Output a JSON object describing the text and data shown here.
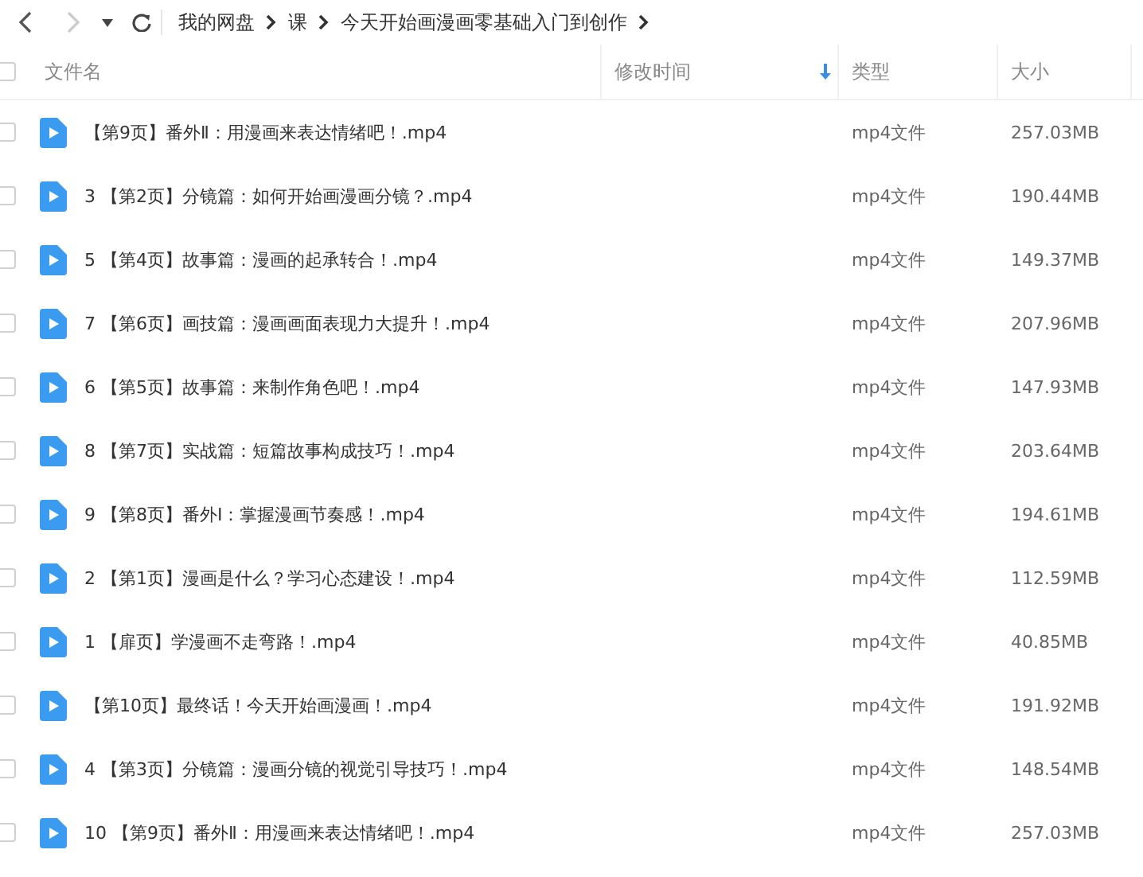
{
  "nav": {
    "back": {
      "disabled": false
    },
    "forward": {
      "disabled": true
    }
  },
  "breadcrumb": [
    "我的网盘",
    "课",
    "今天开始画漫画零基础入门到创作"
  ],
  "table": {
    "select_all": {
      "checked": false
    },
    "columns": [
      {
        "label": "文件名",
        "sorted": false
      },
      {
        "label": "修改时间",
        "sorted": true
      },
      {
        "label": "类型",
        "sorted": false
      },
      {
        "label": "大小",
        "sorted": false
      }
    ],
    "rows": [
      {
        "name": "【第9页】番外Ⅱ：用漫画来表达情绪吧！.mp4",
        "type": "mp4文件",
        "size": "257.03MB",
        "checked": false
      },
      {
        "name": "3 【第2页】分镜篇：如何开始画漫画分镜？.mp4",
        "type": "mp4文件",
        "size": "190.44MB",
        "checked": false
      },
      {
        "name": "5 【第4页】故事篇：漫画的起承转合！.mp4",
        "type": "mp4文件",
        "size": "149.37MB",
        "checked": false
      },
      {
        "name": "7 【第6页】画技篇：漫画画面表现力大提升！.mp4",
        "type": "mp4文件",
        "size": "207.96MB",
        "checked": false
      },
      {
        "name": "6 【第5页】故事篇：来制作角色吧！.mp4",
        "type": "mp4文件",
        "size": "147.93MB",
        "checked": false
      },
      {
        "name": "8 【第7页】实战篇：短篇故事构成技巧！.mp4",
        "type": "mp4文件",
        "size": "203.64MB",
        "checked": false
      },
      {
        "name": "9 【第8页】番外Ⅰ：掌握漫画节奏感！.mp4",
        "type": "mp4文件",
        "size": "194.61MB",
        "checked": false
      },
      {
        "name": "2 【第1页】漫画是什么？学习心态建设！.mp4",
        "type": "mp4文件",
        "size": "112.59MB",
        "checked": false
      },
      {
        "name": "1 【扉页】学漫画不走弯路！.mp4",
        "type": "mp4文件",
        "size": "40.85MB",
        "checked": false
      },
      {
        "name": "【第10页】最终话！今天开始画漫画！.mp4",
        "type": "mp4文件",
        "size": "191.92MB",
        "checked": false
      },
      {
        "name": "4 【第3页】分镜篇：漫画分镜的视觉引导技巧！.mp4",
        "type": "mp4文件",
        "size": "148.54MB",
        "checked": false
      },
      {
        "name": "10 【第9页】番外Ⅱ：用漫画来表达情绪吧！.mp4",
        "type": "mp4文件",
        "size": "257.03MB",
        "checked": false
      }
    ]
  }
}
